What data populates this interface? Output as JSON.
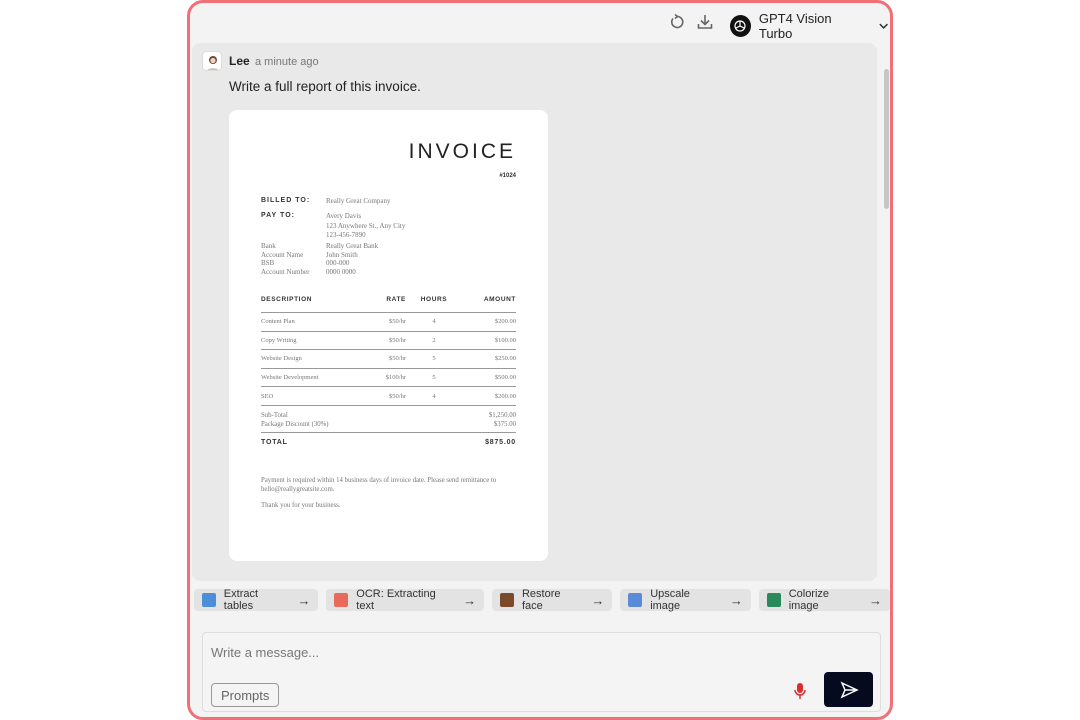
{
  "header": {
    "model_name": "GPT4 Vision Turbo"
  },
  "message": {
    "author": "Lee",
    "time": "a minute ago",
    "text": "Write a full report of this invoice."
  },
  "invoice": {
    "title": "INVOICE",
    "number": "#1024",
    "billed_to_label": "BILLED TO:",
    "billed_to": "Really Great Company",
    "pay_to_label": "PAY TO:",
    "pay_to": [
      "Avery Davis",
      "123 Anywhere St., Any City",
      "123-456-7890"
    ],
    "bank_labels": [
      "Bank",
      "Account Name",
      "BSB",
      "Account Number"
    ],
    "bank_values": [
      "Really Great Bank",
      "John Smith",
      "000-000",
      "0000 0000"
    ],
    "columns": [
      "DESCRIPTION",
      "RATE",
      "HOURS",
      "AMOUNT"
    ],
    "rows": [
      [
        "Content Plan",
        "$50/hr",
        "4",
        "$200.00"
      ],
      [
        "Copy Writing",
        "$50/hr",
        "2",
        "$100.00"
      ],
      [
        "Website Design",
        "$50/hr",
        "5",
        "$250.00"
      ],
      [
        "Website Development",
        "$100/hr",
        "5",
        "$500.00"
      ],
      [
        "SEO",
        "$50/hr",
        "4",
        "$200.00"
      ]
    ],
    "subtotal_label": "Sub-Total",
    "subtotal": "$1,250.00",
    "discount_label": "Package Discount (30%)",
    "discount": "$375.00",
    "total_label": "TOTAL",
    "total": "$875.00",
    "note": "Payment is required within 14 business days of invoice date. Please send remittance to hello@reallygreatsite.com.",
    "thanks": "Thank you for your business."
  },
  "chips": [
    {
      "label": "Extract tables",
      "color": "#4a8fd8"
    },
    {
      "label": "OCR: Extracting text",
      "color": "#e86a5a"
    },
    {
      "label": "Restore face",
      "color": "#7a4a2a"
    },
    {
      "label": "Upscale image",
      "color": "#5a8ad8"
    },
    {
      "label": "Colorize image",
      "color": "#2a8a5a"
    }
  ],
  "composer": {
    "placeholder": "Write a message...",
    "prompts_label": "Prompts"
  }
}
